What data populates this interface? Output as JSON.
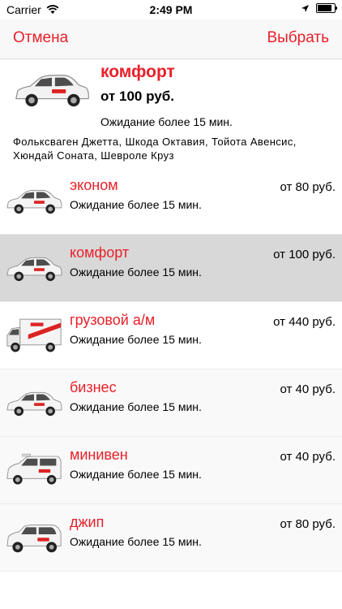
{
  "status_bar": {
    "carrier": "Carrier",
    "time": "2:49 PM",
    "battery_level": 0.9
  },
  "nav": {
    "cancel_label": "Отмена",
    "select_label": "Выбрать"
  },
  "selected": {
    "name": "комфорт",
    "price": "от 100 руб.",
    "wait": "Ожидание более 15 мин.",
    "models": "Фольксваген Джетта, Шкода Октавия, Тойота Авенсис, Хюндай Соната, Шевроле Круз",
    "car_icon": "sedan-icon"
  },
  "tariffs": [
    {
      "name": "эконом",
      "wait": "Ожидание более 15 мин.",
      "price": "от 80 руб.",
      "car_icon": "sedan-icon",
      "selected": false
    },
    {
      "name": "комфорт",
      "wait": "Ожидание более 15 мин.",
      "price": "от 100 руб.",
      "car_icon": "sedan-icon",
      "selected": true
    },
    {
      "name": "грузовой а/м",
      "wait": "Ожидание более 15 мин.",
      "price": "от 440 руб.",
      "car_icon": "truck-icon",
      "selected": false
    },
    {
      "name": "бизнес",
      "wait": "Ожидание более 15 мин.",
      "price": "от 40 руб.",
      "car_icon": "sedan-icon",
      "selected": false
    },
    {
      "name": "минивен",
      "wait": "Ожидание более 15 мин.",
      "price": "от 40 руб.",
      "car_icon": "minivan-icon",
      "selected": false
    },
    {
      "name": "джип",
      "wait": "Ожидание более 15 мин.",
      "price": "от 80 руб.",
      "car_icon": "suv-icon",
      "selected": false
    }
  ],
  "colors": {
    "accent": "#e8202a",
    "selected_row": "#d8d8d8",
    "nav_bg": "#f8f8f8"
  }
}
